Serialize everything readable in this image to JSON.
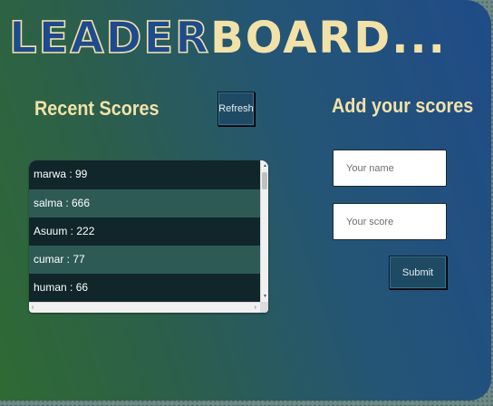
{
  "header": {
    "title_part1": "LEADER",
    "title_part2": "BOARD",
    "title_part3": "..."
  },
  "recent": {
    "heading": "Recent Scores",
    "refresh_label": "Refresh",
    "scores": [
      {
        "text": "marwa : 99"
      },
      {
        "text": "salma : 666"
      },
      {
        "text": "Asuum : 222"
      },
      {
        "text": "cumar : 77"
      },
      {
        "text": "human : 66"
      }
    ]
  },
  "form": {
    "heading": "Add your scores",
    "name_placeholder": "Your name",
    "name_value": "",
    "score_placeholder": "Your score",
    "score_value": "",
    "submit_label": "Submit"
  },
  "colors": {
    "accent_text": "#f2e2a8",
    "title_blue": "#1e4b8e",
    "button_bg": "#1f4a63",
    "row_dark": "#10262a",
    "row_light": "#2e5a56"
  },
  "icons": {
    "scroll_up": "scroll-up-arrow-icon",
    "scroll_down": "scroll-down-arrow-icon",
    "scroll_left": "scroll-left-arrow-icon",
    "scroll_right": "scroll-right-arrow-icon"
  }
}
